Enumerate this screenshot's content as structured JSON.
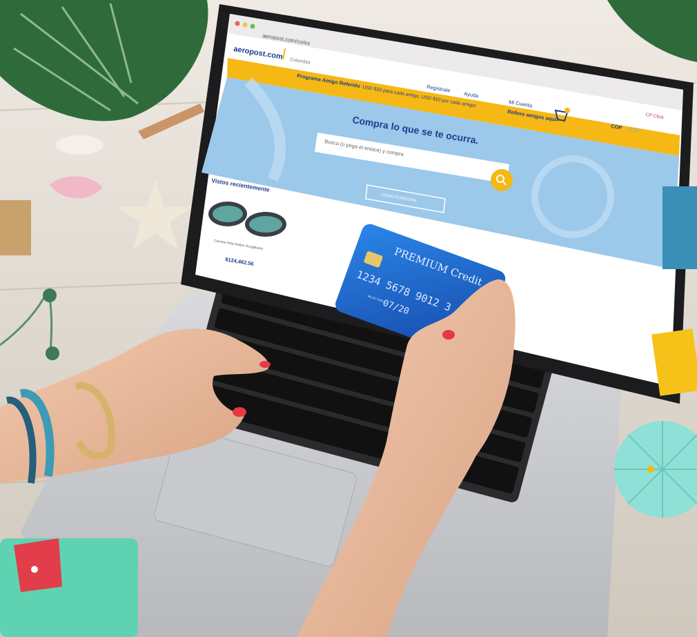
{
  "browser": {
    "url": "aeropost.com/co/es"
  },
  "site": {
    "logo": "aeropost.com",
    "country": "Colombia",
    "promo_prefix": "Programa Amigo Referido",
    "promo_body": "USD $10 para cada amigo, USD $10 por cada amigo!",
    "promo_link": "Refiere amigos aquí>",
    "top_right": "CP Click",
    "nav": {
      "register": "Regístrate",
      "help": "Ayuda",
      "account": "Mi Cuenta",
      "currency_active": "COP",
      "currency_other": "USD"
    },
    "hero_title": "Compra lo que se te ocurra.",
    "search_placeholder": "Busca (o pega el enlace) y compra",
    "how_button": "CÓMO FUNCIONA",
    "recent_title": "Vistos recientemente",
    "recent_item_name": "Carrera Hola Avalon Sunglasses",
    "recent_item_price": "$124,462.56"
  },
  "card": {
    "brand": "PREMIUM Credit",
    "number": "1234 5678 9012 3",
    "valid_label": "VALID THRU",
    "expiry": "07/20"
  },
  "colors": {
    "accent": "#f5b814",
    "hero_blue": "#9cc8ea",
    "card_blue": "#1f6fd1",
    "wood": "#ddd6cb"
  }
}
